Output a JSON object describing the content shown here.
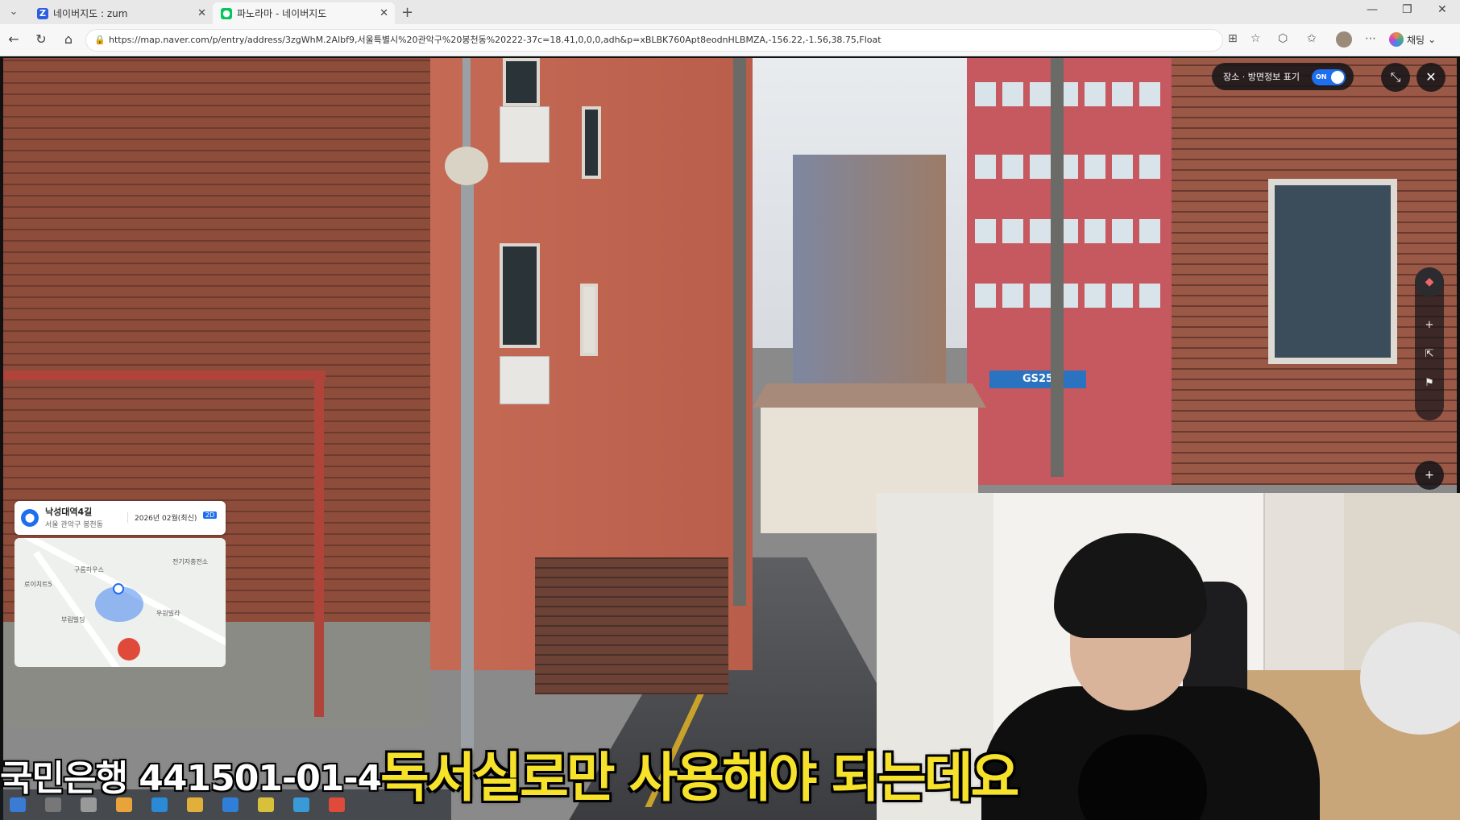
{
  "browser": {
    "tabs": [
      {
        "label": "네이버지도 : zum",
        "icon": "zum-icon",
        "color": "#2b5fe0"
      },
      {
        "label": "파노라마 - 네이버지도",
        "icon": "map-pin-icon",
        "color": "#03c75a"
      }
    ],
    "url": "https://map.naver.com/p/entry/address/3zgWhM.2Albf9,서울특별시%20관악구%20봉천동%20222-37c=18.41,0,0,0,adh&p=xBLBK760Apt8eodnHLBMZA,-156.22,-1.56,38.75,Float",
    "profile_label": "채팅"
  },
  "streetview": {
    "toggle_label": "장소 · 방면정보 표기",
    "toggle_state": "ON",
    "accent": "#1e6ff0",
    "store_sign": "GS25",
    "place": {
      "name": "낙성대역4길",
      "address": "서울 관악구 봉천동",
      "date": "2026년 02월(최신)",
      "badge": "2D"
    },
    "minimap_pois": [
      "구름하우스",
      "전기자충전소",
      "로이치트5",
      "우원빌라",
      "부림빌딩"
    ]
  },
  "subtitles": {
    "account": "국민은행 441501-01-4",
    "main": "독서실로만 사용해야 되는데요",
    "main_color": "#f6e22a"
  }
}
